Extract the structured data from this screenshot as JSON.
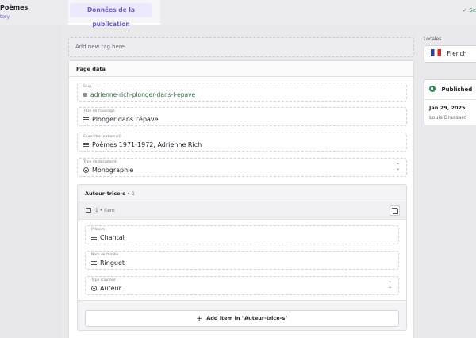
{
  "header": {
    "title": "Poèmes",
    "subtitle": "tory",
    "active_tab": "Données de la publication",
    "status": "✓ Se"
  },
  "tags": {
    "placeholder": "Add new tag here"
  },
  "page_data": {
    "heading": "Page data",
    "slug": {
      "label": "Slug",
      "value": "adrienne-rich-plonger-dans-l-epave"
    },
    "title": {
      "label": "Titre de l'ouvrage",
      "value": "Plonger dans l'épave"
    },
    "subtitle": {
      "label": "Sous-titre (optionnel)",
      "value": "Poèmes 1971-1972, Adrienne Rich"
    },
    "doc_type": {
      "label": "Type de document",
      "value": "Monographie"
    }
  },
  "authors": {
    "heading": "Auteur-trice-s",
    "count": "• 1",
    "item_label": "1 • Item",
    "first_name": {
      "label": "Prénom",
      "value": "Chantal"
    },
    "last_name": {
      "label": "Nom de famille",
      "value": "Ringuet"
    },
    "author_type": {
      "label": "Type d'auteur",
      "value": "Auteur"
    },
    "add_label": "Add item in \"Auteur-trice-s\""
  },
  "sidebar": {
    "locales_label": "Locales",
    "locale": "French",
    "status_title": "Published",
    "date": "Jan 29, 2025",
    "user": "Louis Brassard"
  },
  "colors": {
    "accent": "#6b5bd6",
    "published": "#2f8a4f",
    "slug_text": "#2e6d45"
  }
}
